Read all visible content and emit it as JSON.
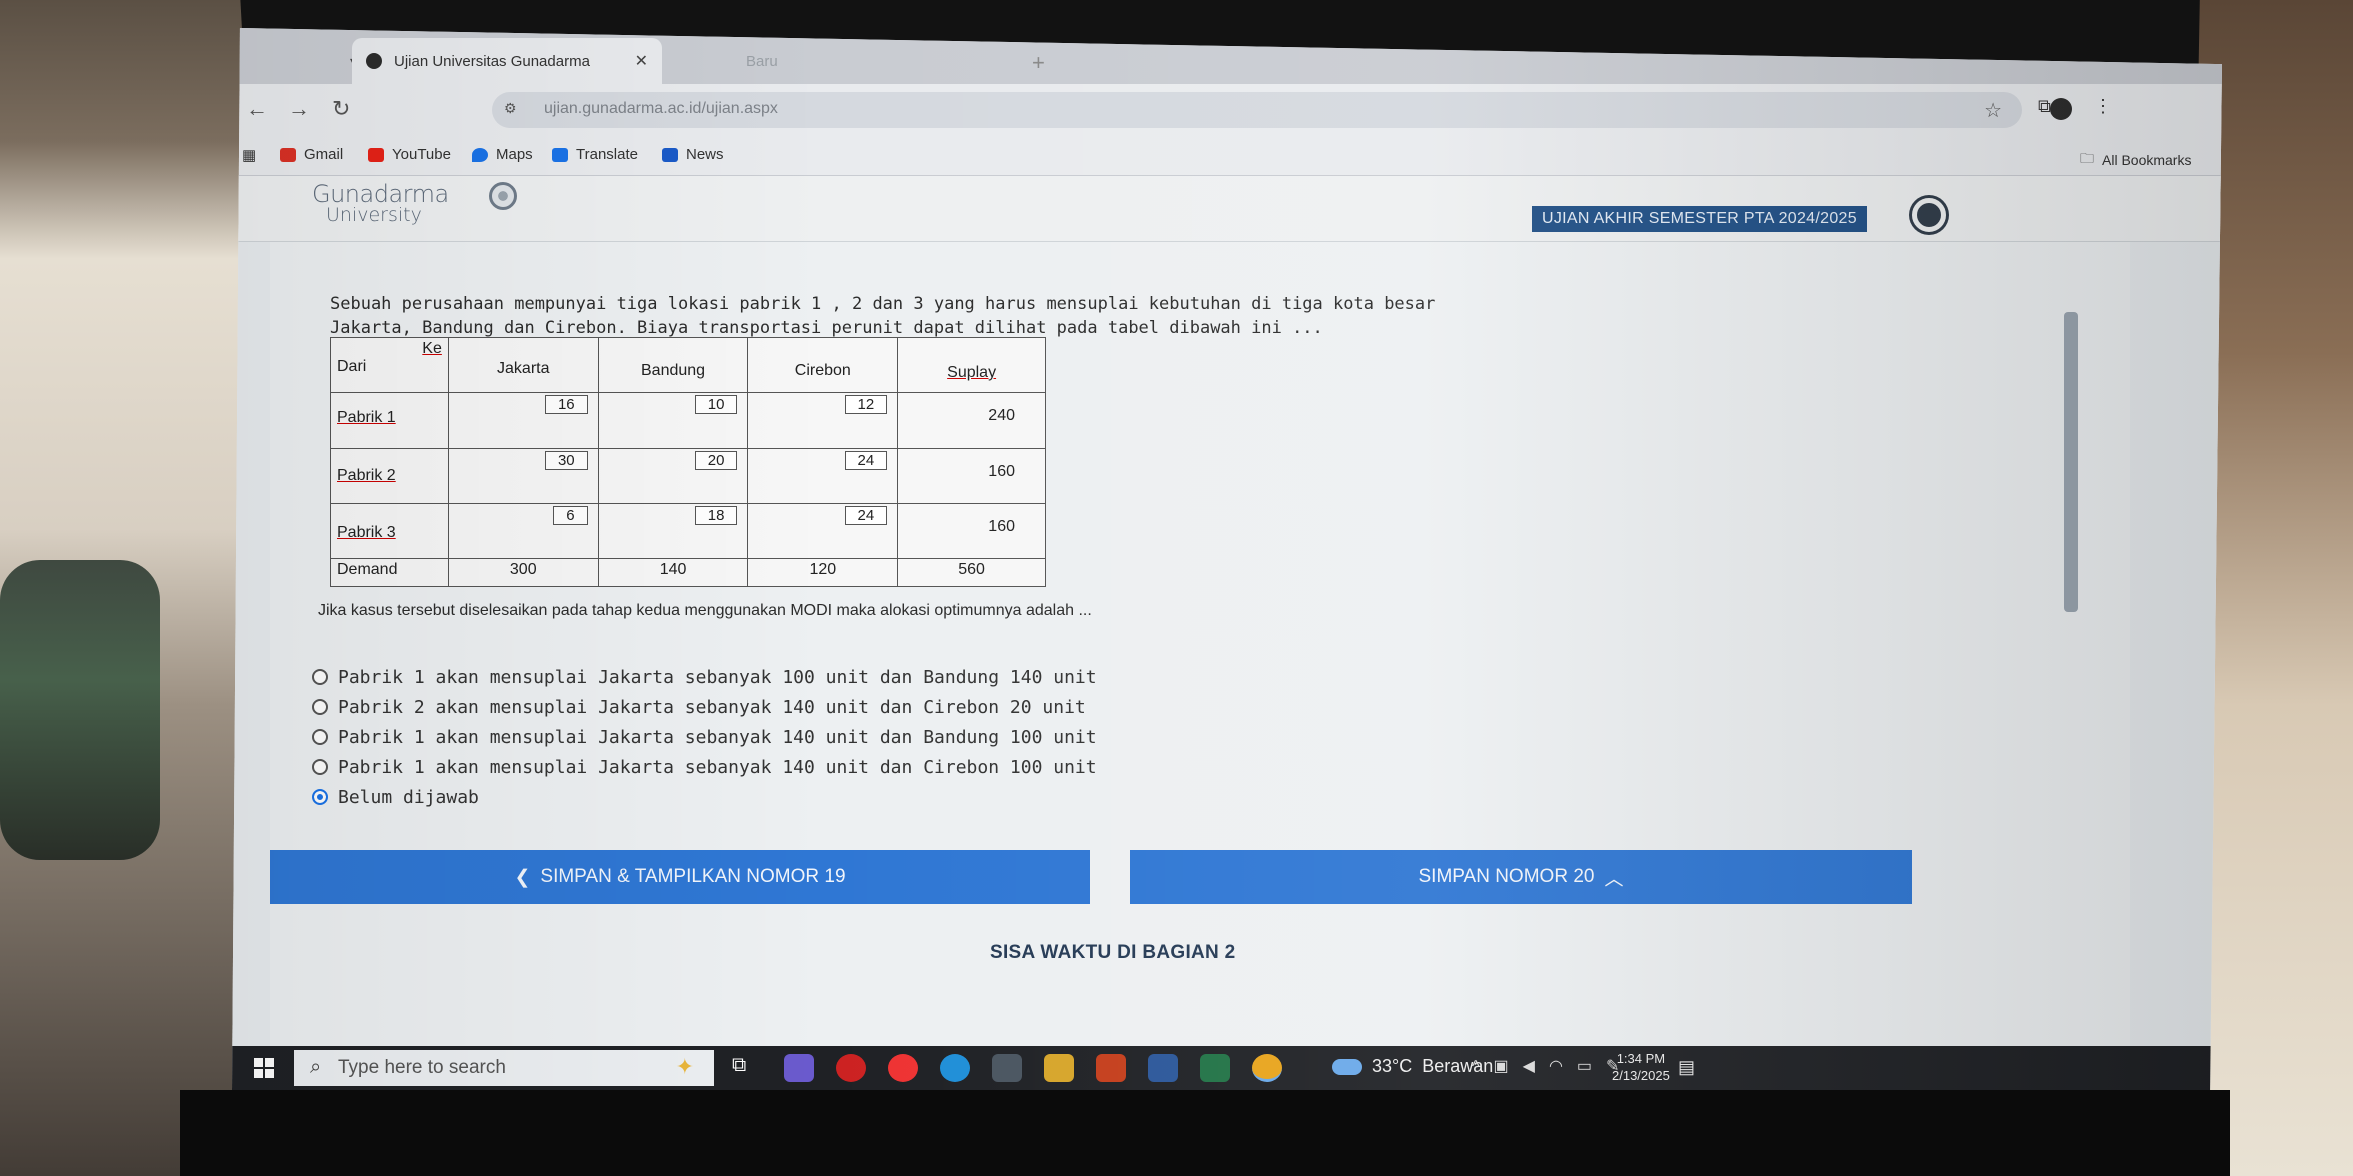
{
  "browser": {
    "tabs": [
      {
        "title": "Ujian Universitas Gunadarma",
        "active": true
      },
      {
        "title": "Baru",
        "active": false
      }
    ],
    "url": "ujian.gunadarma.ac.id/ujian.aspx",
    "bookmarks": [
      {
        "label": "Gmail",
        "icon": "gmail-icon",
        "color": "#d93025"
      },
      {
        "label": "YouTube",
        "icon": "youtube-icon",
        "color": "#e62117"
      },
      {
        "label": "Maps",
        "icon": "maps-icon",
        "color": "#1a73e8"
      },
      {
        "label": "Translate",
        "icon": "translate-icon",
        "color": "#1a73e8"
      },
      {
        "label": "News",
        "icon": "news-icon",
        "color": "#1a5ac8"
      }
    ],
    "all_bookmarks": "All Bookmarks"
  },
  "header": {
    "logo_name": "Gunadarma",
    "logo_sub": "University",
    "exam_badge": "UJIAN AKHIR SEMESTER PTA 2024/2025"
  },
  "question": {
    "text_1": "Sebuah perusahaan mempunyai tiga lokasi pabrik 1 , 2 dan 3 yang harus mensuplai kebutuhan di tiga kota besar",
    "text_2": "Jakarta, Bandung dan Cirebon. Biaya transportasi perunit dapat dilihat pada tabel dibawah ini ...",
    "text_3": "Jika kasus tersebut diselesaikan pada tahap kedua menggunakan MODI  maka alokasi optimumnya adalah ..."
  },
  "table": {
    "ke": "Ke",
    "dari": "Dari",
    "columns": [
      "Jakarta",
      "Bandung",
      "Cirebon",
      "Suplay"
    ],
    "rows": [
      {
        "label": "Pabrik 1",
        "costs": [
          "16",
          "10",
          "12"
        ],
        "supply": "240"
      },
      {
        "label": "Pabrik 2",
        "costs": [
          "30",
          "20",
          "24"
        ],
        "supply": "160"
      },
      {
        "label": "Pabrik 3",
        "costs": [
          "6",
          "18",
          "24"
        ],
        "supply": "160"
      }
    ],
    "demand_label": "Demand",
    "demand": [
      "300",
      "140",
      "120",
      "560"
    ]
  },
  "options": [
    {
      "text": "Pabrik 1 akan mensuplai Jakarta sebanyak 100 unit dan Bandung 140 unit",
      "checked": false
    },
    {
      "text": "Pabrik 2 akan mensuplai Jakarta sebanyak 140 unit dan Cirebon 20 unit",
      "checked": false
    },
    {
      "text": "Pabrik 1 akan mensuplai Jakarta sebanyak 140 unit dan Bandung 100 unit",
      "checked": false
    },
    {
      "text": "Pabrik 1 akan mensuplai Jakarta sebanyak 140 unit dan Cirebon 100 unit",
      "checked": false
    },
    {
      "text": "Belum dijawab",
      "checked": true
    }
  ],
  "nav": {
    "prev_label": "SIMPAN & TAMPILKAN NOMOR 19",
    "next_label": "SIMPAN NOMOR 20",
    "time_label": "SISA WAKTU DI BAGIAN 2"
  },
  "taskbar": {
    "search_placeholder": "Type here to search",
    "temperature": "33°C",
    "weather": "Berawan",
    "time": "1:34 PM",
    "date": "2/13/2025"
  }
}
